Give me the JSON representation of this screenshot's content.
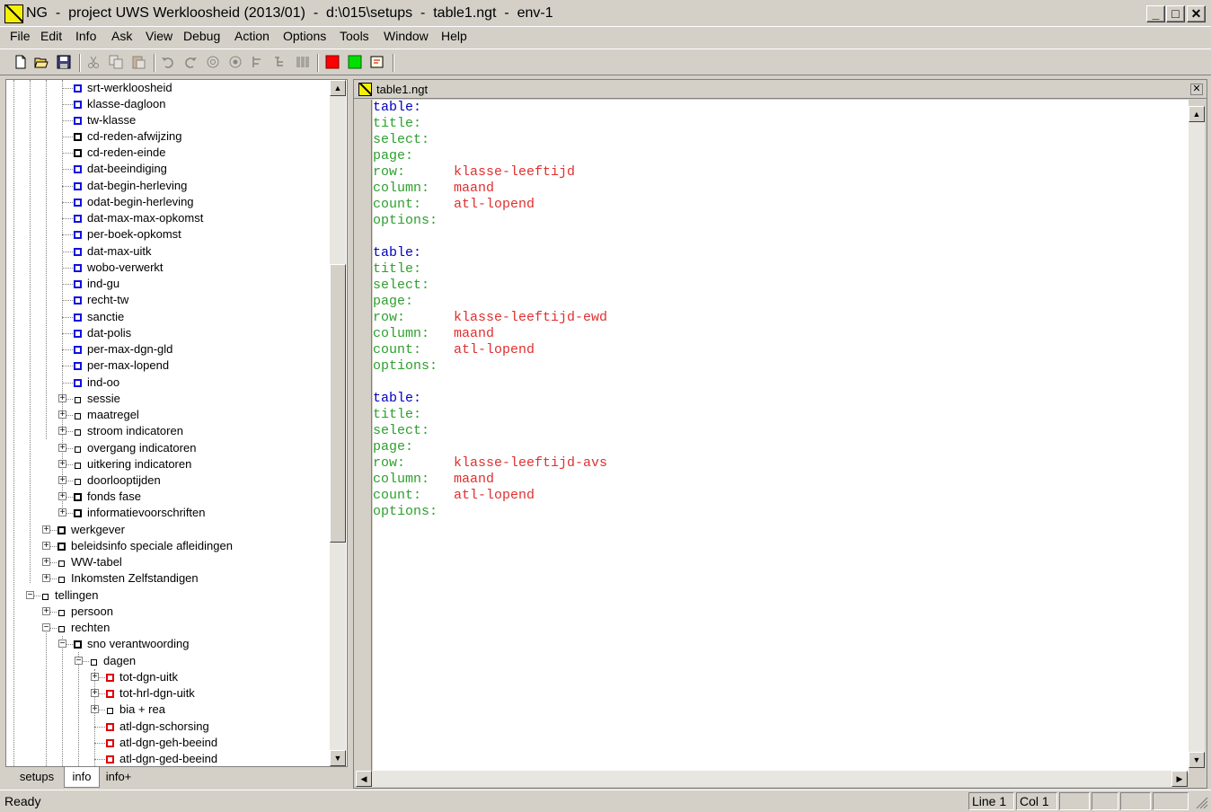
{
  "window": {
    "title": "NG  -  project UWS Werkloosheid (2013/01)  -  d:\\015\\setups  -  table1.ngt  -  env-1"
  },
  "menu": [
    "File",
    "Edit",
    "Info",
    "Ask",
    "View",
    "Debug",
    "Action",
    "Options",
    "Tools",
    "Window",
    "Help"
  ],
  "toolbar": {
    "icons": [
      "new-file-icon",
      "open-folder-icon",
      "save-icon",
      "cut-icon",
      "copy-icon",
      "paste-icon",
      "undo-icon",
      "redo-icon",
      "at-icon",
      "at-alt-icon",
      "flow-icon",
      "tree-icon",
      "barcode-icon",
      "red-square-icon",
      "green-square-icon",
      "note-icon"
    ]
  },
  "colors": {
    "blue_node": "#1010e0",
    "red_node": "#e00000",
    "keyword_blue": "#0000c0",
    "keyword_green": "#2ea02e",
    "value_red": "#e03030"
  },
  "tree": {
    "items": [
      {
        "label": "srt-werkloosheid",
        "box": "blue"
      },
      {
        "label": "klasse-dagloon",
        "box": "blue"
      },
      {
        "label": "tw-klasse",
        "box": "blue"
      },
      {
        "label": "cd-reden-afwijzing",
        "box": "black"
      },
      {
        "label": "cd-reden-einde",
        "box": "black"
      },
      {
        "label": "dat-beeindiging",
        "box": "blue"
      },
      {
        "label": "dat-begin-herleving",
        "box": "blue"
      },
      {
        "label": "odat-begin-herleving",
        "box": "blue"
      },
      {
        "label": "dat-max-max-opkomst",
        "box": "blue"
      },
      {
        "label": "per-boek-opkomst",
        "box": "blue"
      },
      {
        "label": "dat-max-uitk",
        "box": "blue"
      },
      {
        "label": "wobo-verwerkt",
        "box": "blue"
      },
      {
        "label": "ind-gu",
        "box": "blue"
      },
      {
        "label": "recht-tw",
        "box": "blue"
      },
      {
        "label": "sanctie",
        "box": "blue"
      },
      {
        "label": "dat-polis",
        "box": "blue"
      },
      {
        "label": "per-max-dgn-gld",
        "box": "blue"
      },
      {
        "label": "per-max-lopend",
        "box": "blue"
      },
      {
        "label": "ind-oo",
        "box": "blue"
      },
      {
        "label": "sessie",
        "box": "small"
      },
      {
        "label": "maatregel",
        "box": "small"
      },
      {
        "label": "stroom indicatoren",
        "box": "small"
      },
      {
        "label": "overgang indicatoren",
        "box": "small"
      },
      {
        "label": "uitkering indicatoren",
        "box": "small"
      },
      {
        "label": "doorlooptijden",
        "box": "small"
      },
      {
        "label": "fonds fase",
        "box": "black"
      },
      {
        "label": "informatievoorschriften",
        "box": "black"
      },
      {
        "label": "werkgever",
        "box": "black"
      },
      {
        "label": "beleidsinfo speciale afleidingen",
        "box": "black"
      },
      {
        "label": "WW-tabel",
        "box": "small"
      },
      {
        "label": "Inkomsten Zelfstandigen",
        "box": "small"
      },
      {
        "label": "tellingen",
        "box": "small"
      },
      {
        "label": "persoon",
        "box": "small"
      },
      {
        "label": "rechten",
        "box": "small"
      },
      {
        "label": "sno verantwoording",
        "box": "black"
      },
      {
        "label": "dagen",
        "box": "small"
      },
      {
        "label": "tot-dgn-uitk",
        "box": "red"
      },
      {
        "label": "tot-hrl-dgn-uitk",
        "box": "red"
      },
      {
        "label": "bia + rea",
        "box": "small"
      },
      {
        "label": "atl-dgn-schorsing",
        "box": "red"
      },
      {
        "label": "atl-dgn-geh-beeind",
        "box": "red"
      },
      {
        "label": "atl-dgn-ged-beeind",
        "box": "red"
      }
    ]
  },
  "tabs": [
    "setups",
    "info",
    "info+"
  ],
  "active_tab": "info",
  "document": {
    "title": "table1.ngt",
    "blocks": [
      {
        "table": "table:",
        "title": "title:",
        "select": "select:",
        "page": "page:",
        "row_key": "row:",
        "row_val": "klasse-leeftijd",
        "column_key": "column:",
        "column_val": "maand",
        "count_key": "count:",
        "count_val": "atl-lopend",
        "options": "options:"
      },
      {
        "table": "table:",
        "title": "title:",
        "select": "select:",
        "page": "page:",
        "row_key": "row:",
        "row_val": "klasse-leeftijd-ewd",
        "column_key": "column:",
        "column_val": "maand",
        "count_key": "count:",
        "count_val": "atl-lopend",
        "options": "options:"
      },
      {
        "table": "table:",
        "title": "title:",
        "select": "select:",
        "page": "page:",
        "row_key": "row:",
        "row_val": "klasse-leeftijd-avs",
        "column_key": "column:",
        "column_val": "maand",
        "count_key": "count:",
        "count_val": "atl-lopend",
        "options": "options:"
      }
    ]
  },
  "status": {
    "ready": "Ready",
    "line": "Line 1",
    "col": "Col 1"
  }
}
